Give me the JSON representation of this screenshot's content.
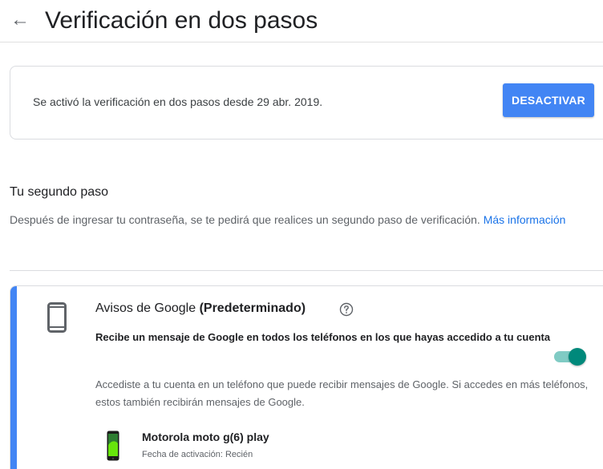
{
  "header": {
    "back_icon": "arrow-left-icon",
    "title": "Verificación en dos pasos"
  },
  "status": {
    "text": "Se activó la verificación en dos pasos desde 29 abr. 2019.",
    "deactivate_label": "DESACTIVAR"
  },
  "second_step": {
    "title": "Tu segundo paso",
    "description": "Después de ingresar tu contraseña, se te pedirá que realices un segundo paso de verificación.",
    "more_info_link": "Más información"
  },
  "method": {
    "icon": "phone-icon",
    "title": "Avisos de Google",
    "title_suffix": "(Predeterminado)",
    "help_icon": "help-circle-icon",
    "subtitle": "Recibe un mensaje de Google en todos los teléfonos en los que hayas accedido a tu cuenta",
    "toggle_on": true,
    "description": "Accediste a tu cuenta en un teléfono que puede recibir mensajes de Google. Si accedes en más teléfonos, estos también recibirán mensajes de Google.",
    "device": {
      "name": "Motorola moto g(6) play",
      "date": "Fecha de activación: Recién"
    }
  },
  "colors": {
    "accent_blue": "#4285f4",
    "link_blue": "#1a73e8",
    "toggle_teal": "#00897b"
  }
}
